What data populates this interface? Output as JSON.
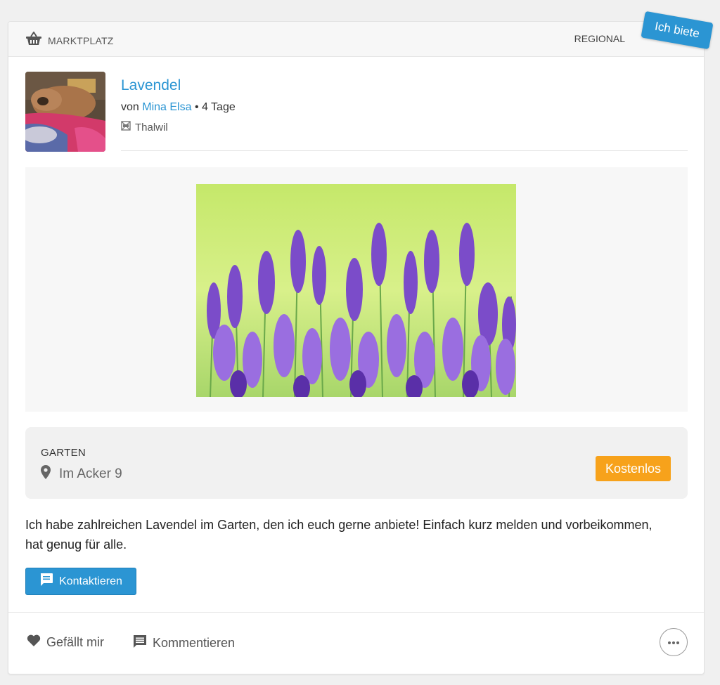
{
  "header": {
    "category": "MARKTPLATZ",
    "scope": "REGIONAL",
    "ribbon": "Ich biete"
  },
  "post": {
    "title": "Lavendel",
    "by": "von",
    "author": "Mina Elsa",
    "age": "• 4 Tage",
    "location": "Thalwil"
  },
  "info": {
    "category": "GARTEN",
    "address": "Im Acker 9",
    "price": "Kostenlos"
  },
  "description": "Ich habe zahlreichen Lavendel im Garten, den ich euch gerne anbiete! Einfach kurz melden und vorbeikommen, hat genug für alle.",
  "actions": {
    "contact": "Kontaktieren",
    "like": "Gefällt mir",
    "comment": "Kommentieren"
  },
  "icons": {
    "category": "basket-icon",
    "location": "flag-icon",
    "address": "map-pin-icon",
    "contact": "chat-icon",
    "like": "heart-icon",
    "comment": "comment-icon",
    "more": "more-icon"
  },
  "colors": {
    "accent": "#2b95d3",
    "price": "#f7a21b"
  }
}
